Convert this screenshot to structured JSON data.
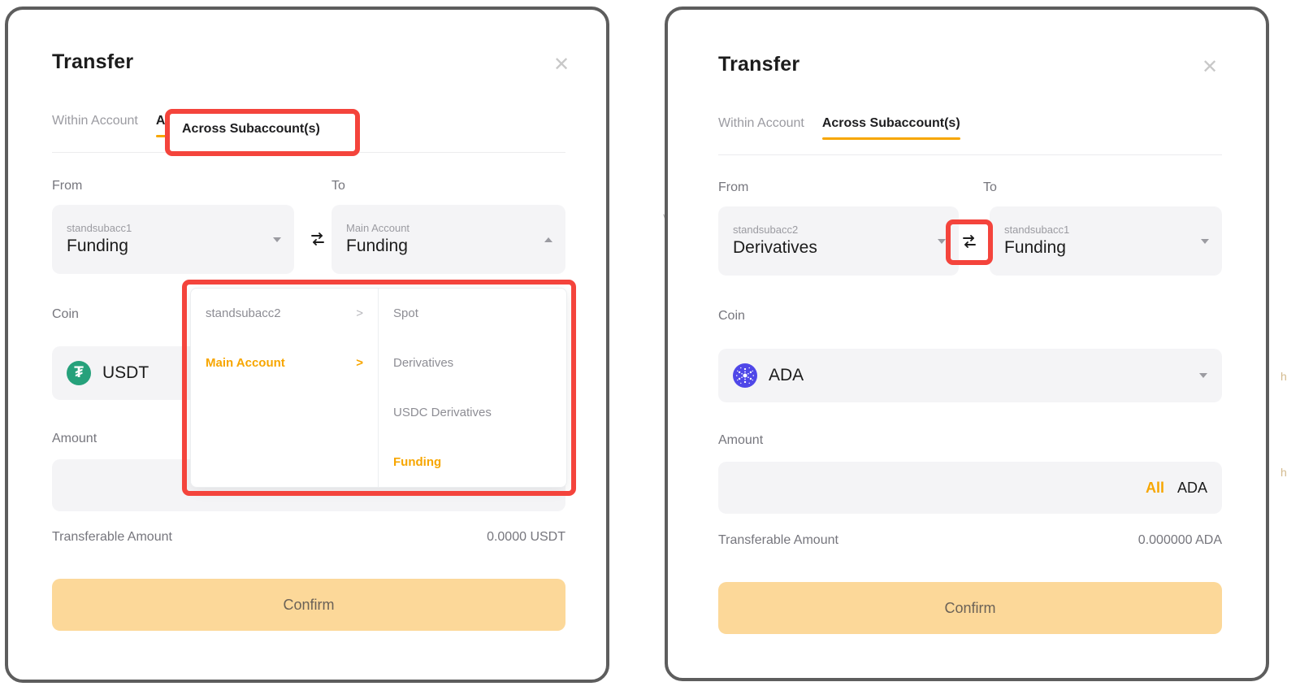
{
  "panels": [
    {
      "id": "left",
      "title": "Transfer",
      "close_icon": "close-icon",
      "tabs": [
        {
          "label": "Within Account",
          "active": false
        },
        {
          "label": "Across Subaccount(s)",
          "active": true
        }
      ],
      "from": {
        "label": "From",
        "account": "standsubacc1",
        "wallet": "Funding",
        "caret": "chevron-down-icon"
      },
      "to": {
        "label": "To",
        "account": "Main Account",
        "wallet": "Funding",
        "caret": "chevron-up-icon"
      },
      "swap_icon": "swap-arrows-icon",
      "coin": {
        "label": "Coin",
        "name": "USDT",
        "icon": "usdt-coin-icon",
        "icon_color": "#26a17b"
      },
      "amount": {
        "label": "Amount",
        "value": "",
        "placeholder": "",
        "all_label": "",
        "unit": ""
      },
      "transferable": {
        "label": "Transferable Amount",
        "value": "0.0000 USDT"
      },
      "confirm_label": "Confirm",
      "dropdown": {
        "accounts": [
          {
            "label": "standsubacc2",
            "chevron": ">",
            "selected": false
          },
          {
            "label": "Main Account",
            "chevron": ">",
            "selected": true
          }
        ],
        "wallets": [
          {
            "label": "Spot",
            "selected": false
          },
          {
            "label": "Derivatives",
            "selected": false
          },
          {
            "label": "USDC Derivatives",
            "selected": false
          },
          {
            "label": "Funding",
            "selected": true
          }
        ]
      }
    },
    {
      "id": "right",
      "title": "Transfer",
      "close_icon": "close-icon",
      "tabs": [
        {
          "label": "Within Account",
          "active": false
        },
        {
          "label": "Across Subaccount(s)",
          "active": true
        }
      ],
      "from": {
        "label": "From",
        "account": "standsubacc2",
        "wallet": "Derivatives",
        "caret": "chevron-down-icon"
      },
      "to": {
        "label": "To",
        "account": "standsubacc1",
        "wallet": "Funding",
        "caret": "chevron-down-icon"
      },
      "swap_icon": "swap-arrows-icon",
      "coin": {
        "label": "Coin",
        "name": "ADA",
        "icon": "ada-coin-icon",
        "icon_color": "#4f47e8"
      },
      "amount": {
        "label": "Amount",
        "value": "",
        "placeholder": "",
        "all_label": "All",
        "unit": "ADA"
      },
      "transferable": {
        "label": "Transferable Amount",
        "value": "0.000000 ADA"
      },
      "confirm_label": "Confirm"
    }
  ],
  "annotations": {
    "accent_color": "#f4443c",
    "items": [
      {
        "name": "highlight-across-subaccounts-tab"
      },
      {
        "name": "highlight-account-dropdown-menu"
      },
      {
        "name": "highlight-swap-direction-button"
      }
    ]
  },
  "theme": {
    "brand_orange": "#f7a600",
    "confirm_bg": "#fcd899",
    "field_bg": "#f4f4f6",
    "panel_border": "#5d5d5d"
  },
  "background_fragments": {
    "left_edge_text": "v",
    "right_edge_text_1": "h",
    "right_edge_text_2": "h"
  }
}
